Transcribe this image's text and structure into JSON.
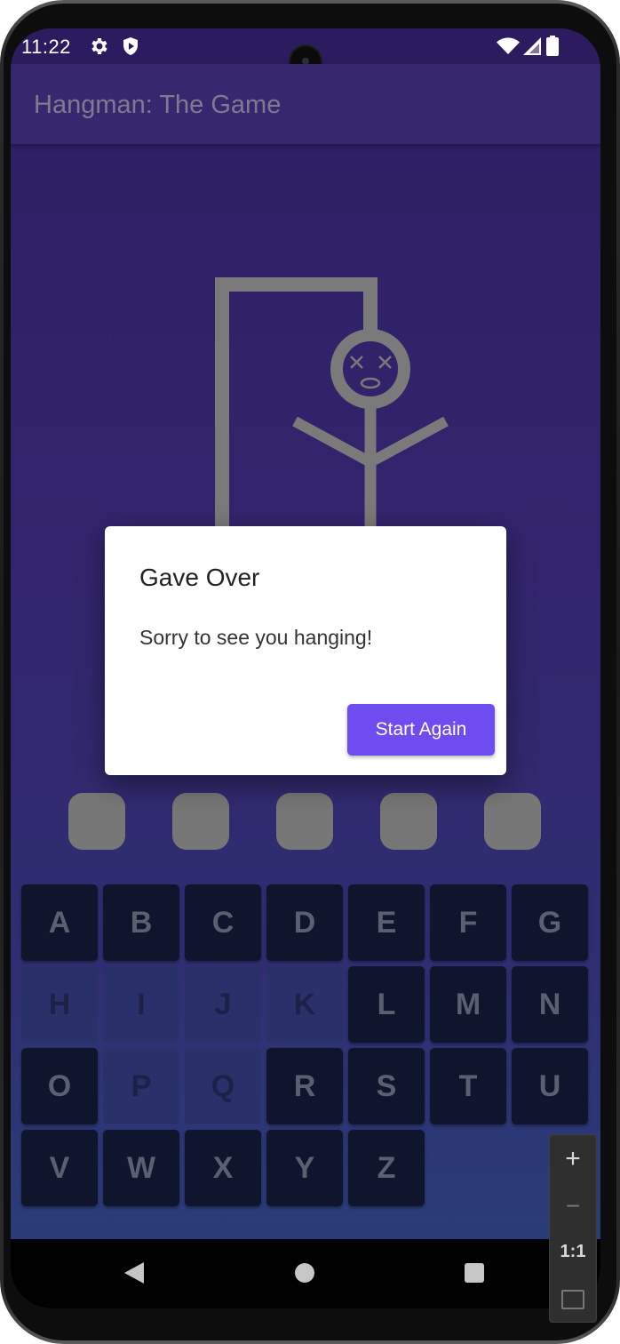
{
  "status": {
    "time": "11:22",
    "icons": [
      "gear-icon",
      "shield-play-icon",
      "wifi-icon",
      "signal-icon",
      "battery-icon"
    ]
  },
  "app": {
    "title": "Hangman: The Game",
    "accent": "#6f4cf0",
    "background": "#33246d"
  },
  "hangman": {
    "mistakes": 6,
    "state": "dead-face-x-eyes"
  },
  "word_slots": [
    "",
    "",
    "",
    "",
    ""
  ],
  "keyboard": {
    "rows": [
      [
        {
          "letter": "A",
          "used": false
        },
        {
          "letter": "B",
          "used": false
        },
        {
          "letter": "C",
          "used": false
        },
        {
          "letter": "D",
          "used": false
        },
        {
          "letter": "E",
          "used": false
        },
        {
          "letter": "F",
          "used": false
        },
        {
          "letter": "G",
          "used": false
        }
      ],
      [
        {
          "letter": "H",
          "used": true
        },
        {
          "letter": "I",
          "used": true
        },
        {
          "letter": "J",
          "used": true
        },
        {
          "letter": "K",
          "used": true
        },
        {
          "letter": "L",
          "used": false
        },
        {
          "letter": "M",
          "used": false
        },
        {
          "letter": "N",
          "used": false
        }
      ],
      [
        {
          "letter": "O",
          "used": false
        },
        {
          "letter": "P",
          "used": true
        },
        {
          "letter": "Q",
          "used": true
        },
        {
          "letter": "R",
          "used": false
        },
        {
          "letter": "S",
          "used": false
        },
        {
          "letter": "T",
          "used": false
        },
        {
          "letter": "U",
          "used": false
        }
      ],
      [
        {
          "letter": "V",
          "used": false
        },
        {
          "letter": "W",
          "used": false
        },
        {
          "letter": "X",
          "used": false
        },
        {
          "letter": "Y",
          "used": false
        },
        {
          "letter": "Z",
          "used": false
        }
      ]
    ]
  },
  "dialog": {
    "title": "Gave Over",
    "message": "Sorry to see you hanging!",
    "button_label": "Start Again"
  },
  "zoom_controls": {
    "zoom_in": "+",
    "zoom_out": "−",
    "actual_size": "1:1"
  },
  "navbar": {
    "icons": [
      "back-icon",
      "home-icon",
      "recents-icon"
    ]
  }
}
